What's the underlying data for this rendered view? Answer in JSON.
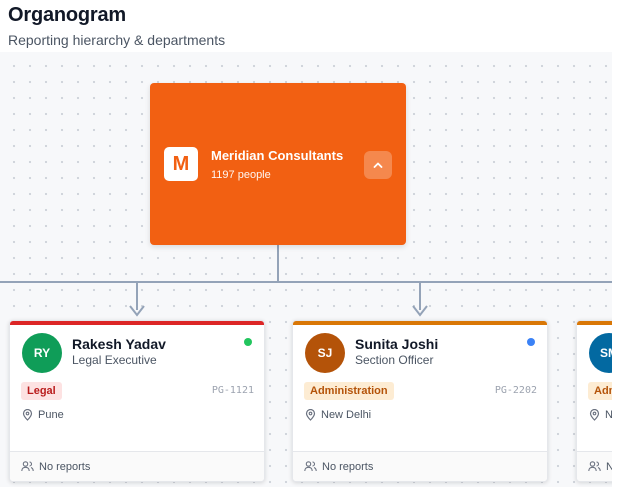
{
  "header": {
    "title": "Organogram",
    "subtitle": "Reporting hierarchy & departments"
  },
  "root": {
    "logo_letter": "M",
    "name": "Meridian Consultants",
    "count": "1197 people",
    "color": "#f26012"
  },
  "people": [
    {
      "initials": "RY",
      "name": "Rakesh Yadav",
      "role": "Legal Executive",
      "department": "Legal",
      "emp_id": "PG-1121",
      "location": "Pune",
      "reports": "No reports",
      "avatar_color": "#0f9d58",
      "accent_color": "#dc2626",
      "status_color": "#22c55e",
      "badge_bg": "#fde2e2",
      "badge_color": "#b91c1c"
    },
    {
      "initials": "SJ",
      "name": "Sunita Joshi",
      "role": "Section Officer",
      "department": "Administration",
      "emp_id": "PG-2202",
      "location": "New Delhi",
      "reports": "No reports",
      "avatar_color": "#b45309",
      "accent_color": "#d97706",
      "status_color": "#3b82f6",
      "badge_bg": "#fdecd3",
      "badge_color": "#b45309"
    },
    {
      "initials": "SM",
      "name": "",
      "role": "",
      "department": "Administration",
      "emp_id": "",
      "location": "N",
      "reports": "N",
      "avatar_color": "#0369a1",
      "accent_color": "#d97706",
      "status_color": "",
      "badge_bg": "#fdecd3",
      "badge_color": "#b45309"
    }
  ],
  "connector_color": "#94a3b8"
}
